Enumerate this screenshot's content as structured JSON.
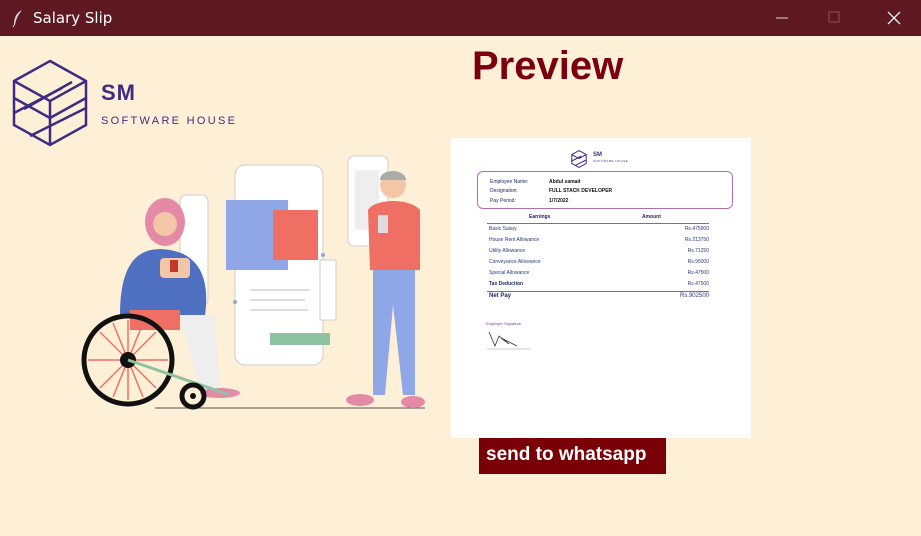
{
  "window": {
    "title": "Salary Slip",
    "icon": "feather-icon"
  },
  "logo": {
    "initials": "SM",
    "tagline": "SOFTWARE HOUSE"
  },
  "preview": {
    "heading": "Preview",
    "slip": {
      "logo_initials": "SM",
      "logo_tagline": "SOFTWARE HOUSE",
      "employee_name_label": "Employee Name:",
      "employee_name": "Abdul samad",
      "designation_label": "Designation:",
      "designation": "FULL STACK DEVELOPER",
      "pay_period_label": "Pay Period:",
      "pay_period": "1/7/2022",
      "earnings_header": "Earnings",
      "amount_header": "Amount",
      "items": [
        {
          "label": "Basic Salary",
          "amount": "Rs.475000"
        },
        {
          "label": "House Rent Allowance",
          "amount": "Rs.213750"
        },
        {
          "label": "Utility Allowance",
          "amount": "Rs.71250"
        },
        {
          "label": "Conveyance Allowance",
          "amount": "Rs.95000"
        },
        {
          "label": "Special  Allowance",
          "amount": "Rs.47500"
        }
      ],
      "tax_label": "Tax Deduction",
      "tax_amount": "Rs.47500",
      "net_label": "Net Pay",
      "net_amount": "Rs.902500",
      "signature_label": "Employer  Signature"
    }
  },
  "actions": {
    "send_whatsapp": "send  to whatsapp"
  },
  "colors": {
    "titlebar": "#5e1822",
    "background": "#fef0d6",
    "accent": "#7a0008",
    "brand": "#3f2b84"
  }
}
